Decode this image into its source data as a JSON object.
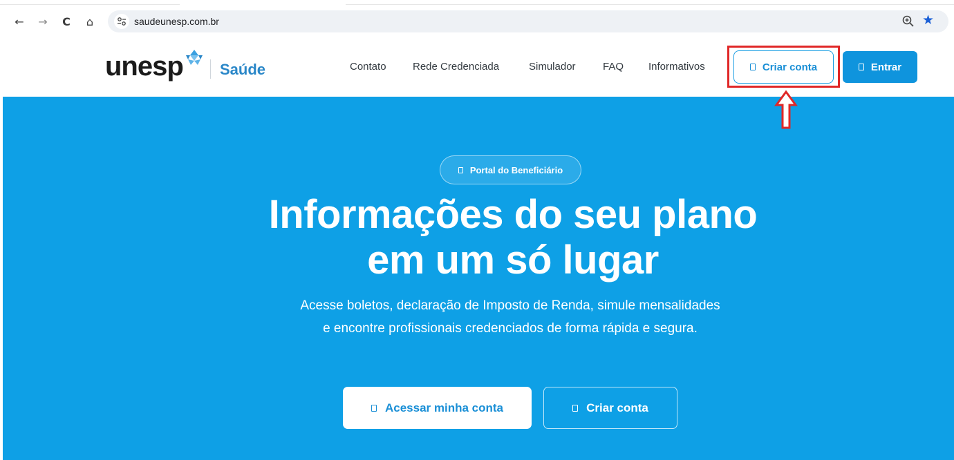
{
  "browser": {
    "back_icon": "←",
    "forward_icon": "→",
    "reload_icon": "C",
    "home_icon": "⌂",
    "url": "saudeunesp.com.br",
    "star_icon": "★"
  },
  "header": {
    "logo_text": "unesp",
    "logo_sub": "Saúde",
    "nav": [
      "Contato",
      "Rede Credenciada",
      "Simulador",
      "FAQ",
      "Informativos"
    ],
    "criar_conta": "Criar conta",
    "entrar": "Entrar"
  },
  "hero": {
    "badge": "Portal do Beneficiário",
    "title_line1": "Informações do seu plano",
    "title_line2": "em um só lugar",
    "subtitle": "Acesse boletos, declaração de Imposto de Renda, simule mensalidades e encontre profissionais credenciados de forma rápida e segura.",
    "btn_acessar": "Acessar minha conta",
    "btn_criar": "Criar conta"
  },
  "colors": {
    "hero_bg": "#0ea0e6",
    "accent": "#0f94dd",
    "highlight": "#e02727"
  }
}
